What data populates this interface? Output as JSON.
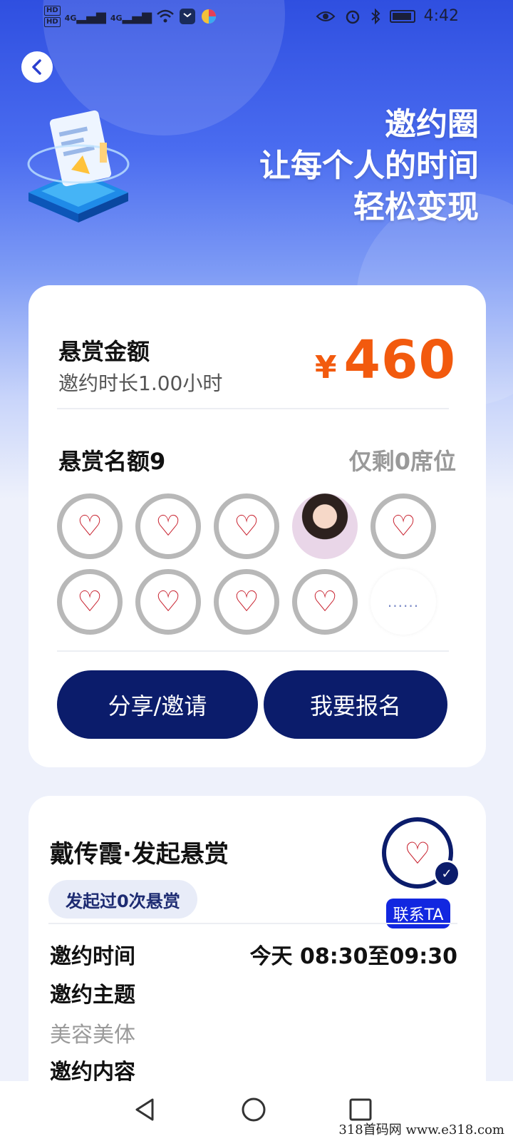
{
  "status_bar": {
    "signal_1": "4G",
    "signal_2": "4G",
    "time": "4:42"
  },
  "hero": {
    "line1": "邀约圈",
    "line2": "让每个人的时间",
    "line3": "轻松变现"
  },
  "reward": {
    "label": "悬赏金额",
    "duration": "邀约时长1.00小时",
    "currency": "¥",
    "amount": "460",
    "slots_label": "悬赏名额9",
    "slots_remaining": "仅剩0席位",
    "avatars": [
      "logo",
      "logo",
      "logo",
      "photo",
      "logo",
      "logo",
      "logo",
      "logo",
      "logo",
      "more"
    ],
    "more_dots": "......",
    "share_button": "分享/邀请",
    "signup_button": "我要报名"
  },
  "publisher": {
    "name": "戴传霞·发起悬赏",
    "count_badge": "发起过0次悬赏",
    "contact_button": "联系TA"
  },
  "details": {
    "time_label": "邀约时间",
    "time_value": "今天 08:30至09:30",
    "topic_label": "邀约主题",
    "topic_value": "美容美体",
    "content_label": "邀约内容"
  },
  "watermark": "318首码网  www.e318.com",
  "colors": {
    "primary": "#0b1c6b",
    "accent": "#f25a0e",
    "contact": "#1227e0"
  }
}
